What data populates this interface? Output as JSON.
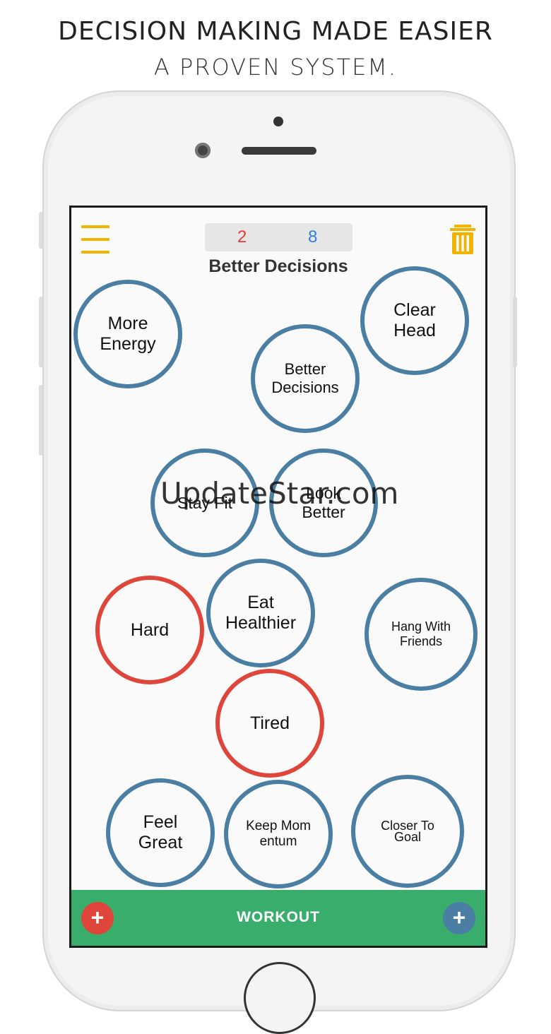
{
  "promo": {
    "headline": "DECISION MAKING MADE EASIER",
    "subheadline": "A PROVEN SYSTEM."
  },
  "header": {
    "red_count": "2",
    "blue_count": "8",
    "title": "Better Decisions",
    "menu_icon": "hamburger-menu-icon",
    "trash_icon": "trash-icon"
  },
  "bubbles": [
    {
      "label": "More Energy",
      "color": "blue"
    },
    {
      "label": "Clear Head",
      "color": "blue"
    },
    {
      "label": "Better Decisions",
      "color": "blue"
    },
    {
      "label": "Stay Fit",
      "color": "blue"
    },
    {
      "label": "Look Better",
      "color": "blue"
    },
    {
      "label": "Eat Healthier",
      "color": "blue"
    },
    {
      "label": "Hard",
      "color": "red"
    },
    {
      "label": "Hang With Friends",
      "color": "blue"
    },
    {
      "label": "Tired",
      "color": "red"
    },
    {
      "label": "Feel Great",
      "color": "blue"
    },
    {
      "label": "Keep Momentum",
      "color": "blue"
    },
    {
      "label": "Closer To Goal",
      "color": "blue"
    }
  ],
  "watermark": "UpdateStar.com",
  "bottom_bar": {
    "label": "WORKOUT",
    "left_button": "+",
    "right_button": "+"
  },
  "colors": {
    "accent_yellow": "#f0b400",
    "bubble_blue": "#4a7ea3",
    "bubble_red": "#e0453c",
    "bar_green": "#39ae6c",
    "count_red": "#e0403a",
    "count_blue": "#2f7fe0"
  }
}
